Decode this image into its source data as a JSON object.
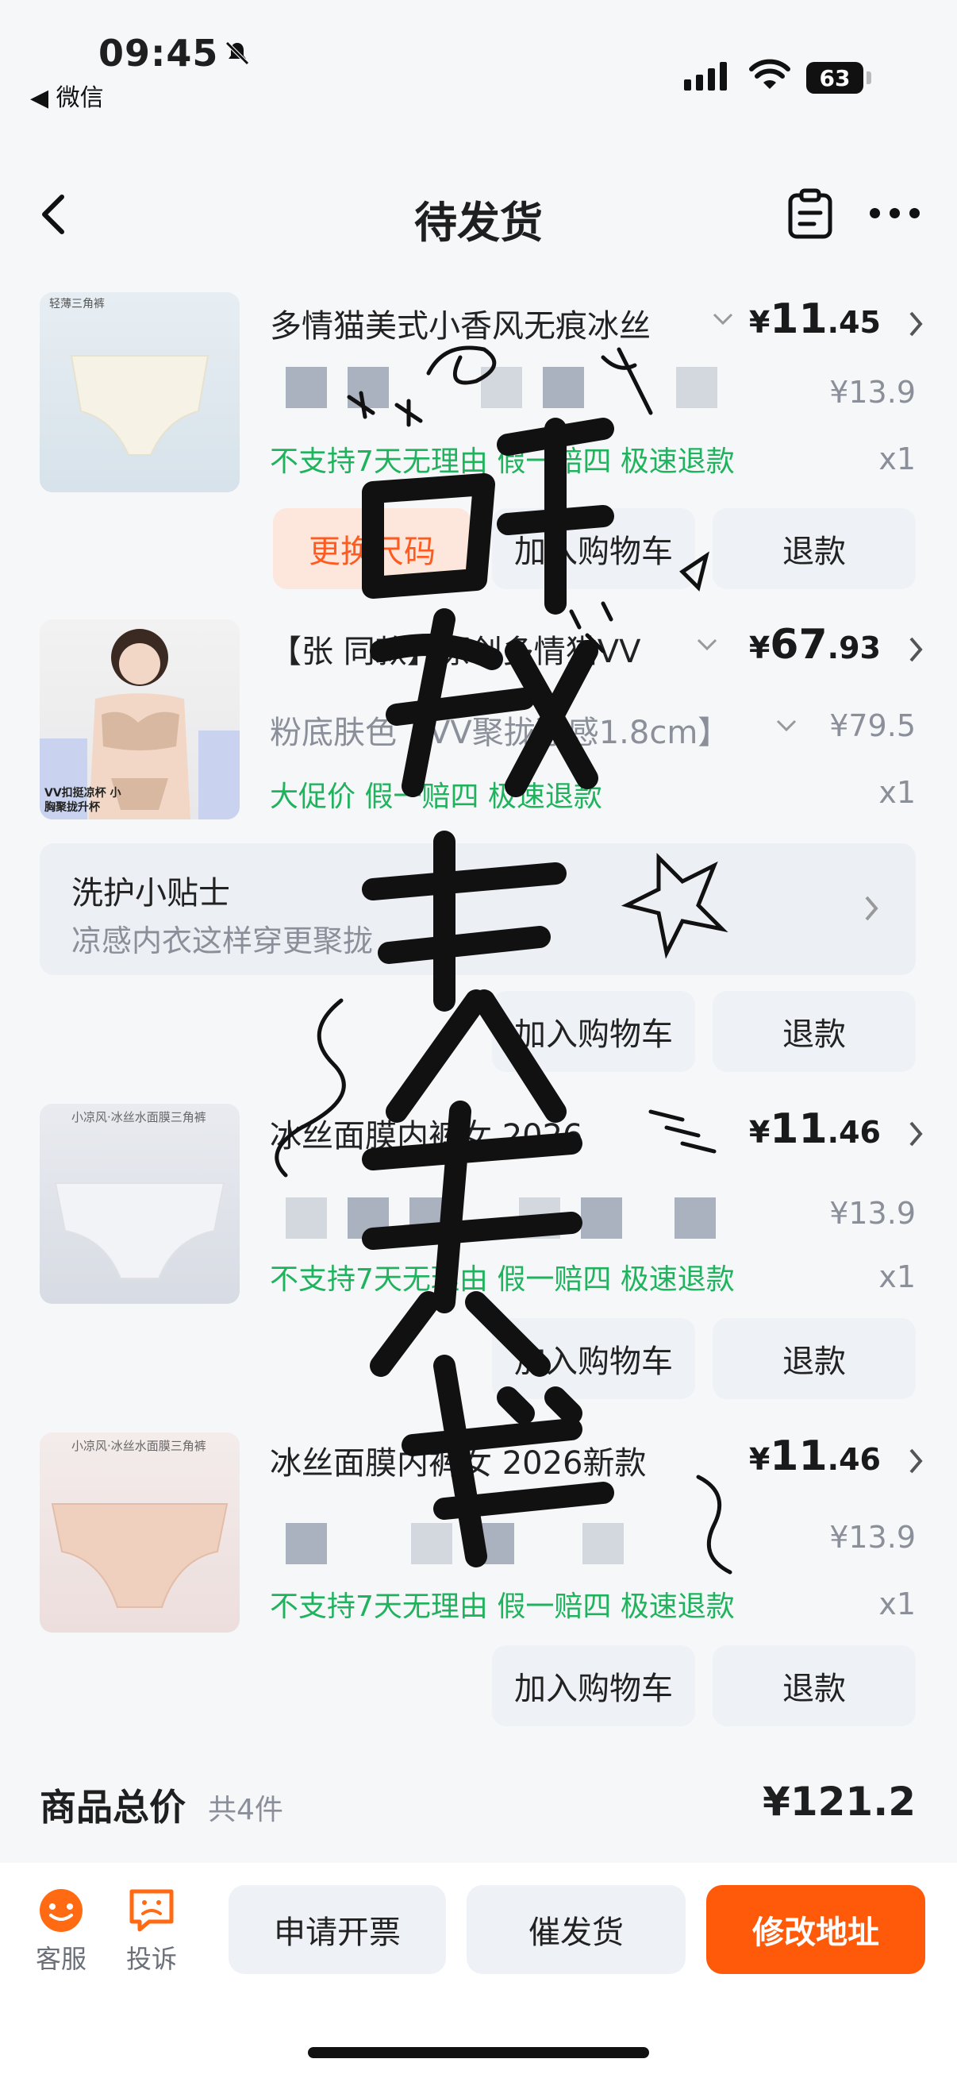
{
  "status_bar": {
    "time": "09:45",
    "back_app": "◀ 微信",
    "battery": "63"
  },
  "nav": {
    "title": "待发货"
  },
  "items": [
    {
      "title": "多情猫美式小香风无痕冰丝",
      "price_currency": "¥",
      "price_int": "11",
      "price_dec": ".45",
      "original_price": "¥13.9",
      "tags": "不支持7天无理由  假一赔四  极速退款",
      "qty": "x1",
      "btn_exchange": "更换尺码",
      "btn_cart": "加入购物车",
      "btn_refund": "退款",
      "thumb_label": "轻薄三角裤"
    },
    {
      "title": "【张 同款】原创多情猫VV",
      "spec": "粉底肤色【VV聚拢凉感1.8cm】",
      "price_currency": "¥",
      "price_int": "67",
      "price_dec": ".93",
      "original_price": "¥79.5",
      "tags": "大促价  假一赔四  极速退款",
      "qty": "x1",
      "thumb_label": "VV扣挺凉杯 小胸聚拢升杯"
    },
    {
      "title": "冰丝面膜内裤女 2026",
      "price_currency": "¥",
      "price_int": "11",
      "price_dec": ".46",
      "original_price": "¥13.9",
      "tags": "不支持7天无理由  假一赔四  极速退款",
      "qty": "x1",
      "btn_cart": "加入购物车",
      "btn_refund": "退款",
      "thumb_label": "小凉风·冰丝水面膜三角裤"
    },
    {
      "title": "冰丝面膜内裤女 2026新款",
      "price_currency": "¥",
      "price_int": "11",
      "price_dec": ".46",
      "original_price": "¥13.9",
      "tags": "不支持7天无理由  假一赔四  极速退款",
      "qty": "x1",
      "btn_cart": "加入购物车",
      "btn_refund": "退款",
      "thumb_label": "小凉风·冰丝水面膜三角裤"
    }
  ],
  "care_tip": {
    "title": "洗护小贴士",
    "subtitle": "凉感内衣这样穿更聚拢",
    "btn_cart": "加入购物车",
    "btn_refund": "退款"
  },
  "total": {
    "label": "商品总价",
    "count": "共4件",
    "amount": "¥121.2"
  },
  "bottom_bar": {
    "service": "客服",
    "complaint": "投诉",
    "invoice": "申请开票",
    "urge": "催发货",
    "modify_address": "修改地址"
  },
  "colors": {
    "accent": "#ff5a0a",
    "tag_green": "#1fb35d",
    "muted": "#8a8f99"
  }
}
